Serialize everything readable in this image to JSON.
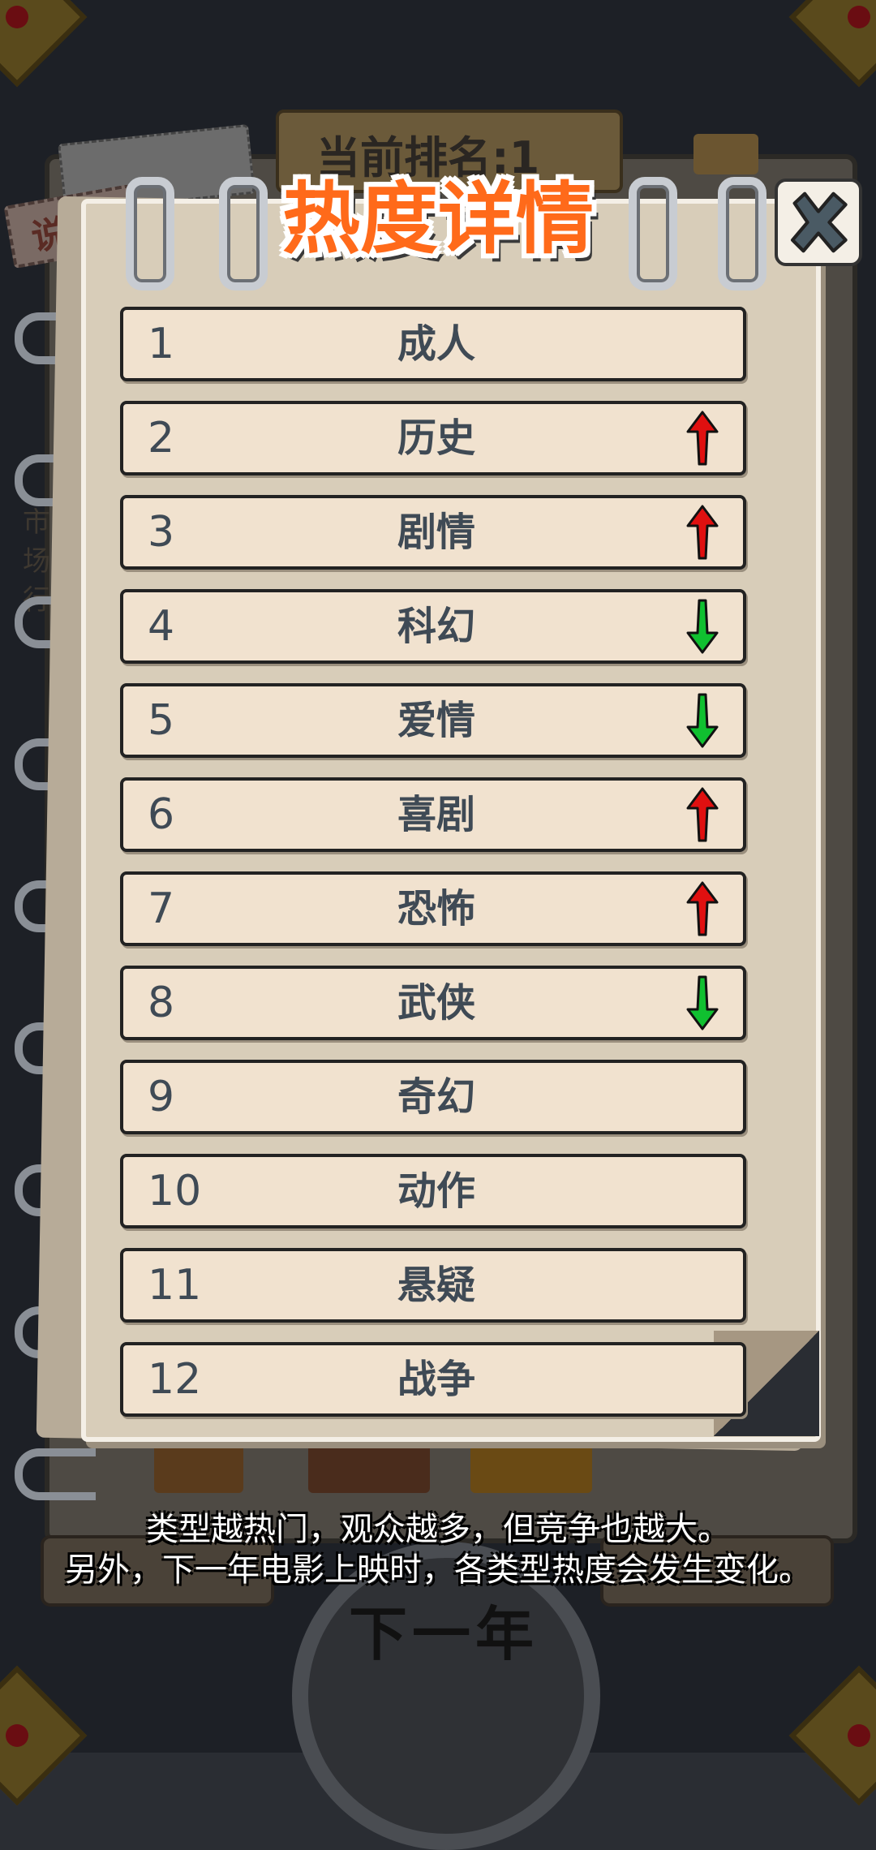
{
  "background": {
    "rank_text": "当前排名:1",
    "tab_label": "说明",
    "side_text": "市场行",
    "next_year_button": "下一年"
  },
  "modal": {
    "title": "热度详情",
    "close_icon": "close-x-icon"
  },
  "rankings": [
    {
      "rank": "1",
      "genre": "成人",
      "trend": "none"
    },
    {
      "rank": "2",
      "genre": "历史",
      "trend": "up"
    },
    {
      "rank": "3",
      "genre": "剧情",
      "trend": "up"
    },
    {
      "rank": "4",
      "genre": "科幻",
      "trend": "down"
    },
    {
      "rank": "5",
      "genre": "爱情",
      "trend": "down"
    },
    {
      "rank": "6",
      "genre": "喜剧",
      "trend": "up"
    },
    {
      "rank": "7",
      "genre": "恐怖",
      "trend": "up"
    },
    {
      "rank": "8",
      "genre": "武侠",
      "trend": "down"
    },
    {
      "rank": "9",
      "genre": "奇幻",
      "trend": "none"
    },
    {
      "rank": "10",
      "genre": "动作",
      "trend": "none"
    },
    {
      "rank": "11",
      "genre": "悬疑",
      "trend": "none"
    },
    {
      "rank": "12",
      "genre": "战争",
      "trend": "none"
    }
  ],
  "footer": {
    "line1": "类型越热门，观众越多，但竞争也越大。",
    "line2": "另外，下一年电影上映时，各类型热度会发生变化。"
  },
  "colors": {
    "up": "#e01010",
    "down": "#10c030",
    "title": "#ff6a1a"
  }
}
